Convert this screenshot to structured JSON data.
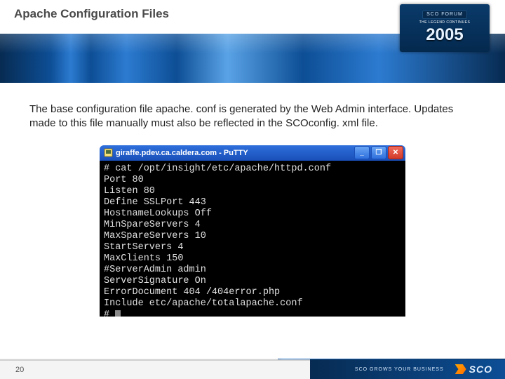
{
  "slide": {
    "title": "Apache Configuration Files",
    "body": "The base configuration file apache. conf is generated by the Web Admin interface.  Updates made to this file manually must also be reflected in the SCOconfig. xml file."
  },
  "forum_badge": {
    "tag": "SCO FORUM",
    "legend": "THE LEGEND CONTINUES",
    "year": "2005"
  },
  "terminal_window": {
    "title": "giraffe.pdev.ca.caldera.com - PuTTY",
    "buttons": {
      "min": "_",
      "max": "❐",
      "close": "✕"
    }
  },
  "terminal_lines": [
    "# cat /opt/insight/etc/apache/httpd.conf",
    "Port 80",
    "Listen 80",
    "Define SSLPort 443",
    "HostnameLookups Off",
    "MinSpareServers 4",
    "MaxSpareServers 10",
    "StartServers 4",
    "MaxClients 150",
    "#ServerAdmin admin",
    "ServerSignature On",
    "ErrorDocument 404 /404error.php",
    "Include etc/apache/totalapache.conf",
    "# "
  ],
  "footer": {
    "page": "20",
    "tagline": "SCO GROWS YOUR BUSINESS",
    "logo_text": "SCO"
  }
}
